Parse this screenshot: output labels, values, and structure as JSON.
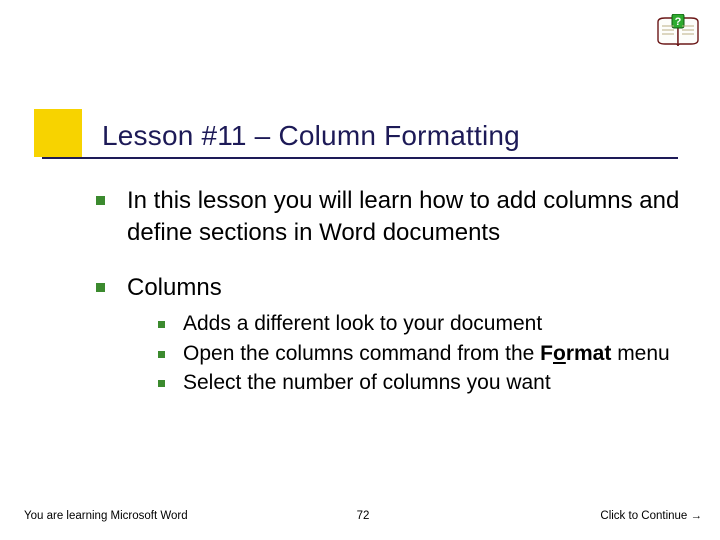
{
  "title": "Lesson #11 – Column Formatting",
  "bullets": [
    {
      "text": "In this lesson you will learn how to add columns and define sections in Word documents"
    },
    {
      "text": "Columns"
    }
  ],
  "sub_bullets": [
    {
      "text": "Adds a different look to your document"
    },
    {
      "pre": "Open the columns command from the ",
      "bold_pre": "F",
      "bold_u": "o",
      "bold_post": "rmat",
      "post": " menu"
    },
    {
      "text": "Select the number of columns you want"
    }
  ],
  "footer": {
    "left": "You are learning Microsoft Word",
    "page": "72",
    "right": "Click to Continue →"
  },
  "icons": {
    "help": "help-book-icon"
  }
}
